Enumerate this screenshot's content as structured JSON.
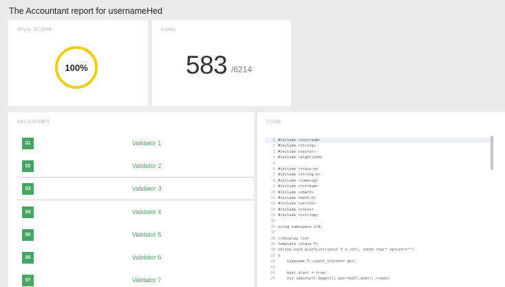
{
  "page": {
    "title": "The Accountant report for usernameHed"
  },
  "score": {
    "label": "FINAL SCORE",
    "value": "100%"
  },
  "rank": {
    "label": "RANK",
    "position": "583",
    "total": "/6214"
  },
  "validators": {
    "label": "VALIDATORS",
    "items": [
      {
        "badge": "01",
        "name": "Validator 1"
      },
      {
        "badge": "02",
        "name": "Validator 2"
      },
      {
        "badge": "03",
        "name": "Validator 3"
      },
      {
        "badge": "04",
        "name": "Validator 4"
      },
      {
        "badge": "05",
        "name": "Validator 5"
      },
      {
        "badge": "06",
        "name": "Validator 6"
      },
      {
        "badge": "07",
        "name": "Validator 7"
      }
    ]
  },
  "code": {
    "label": "CODE",
    "lines": [
      {
        "n": "1",
        "t": "#include <iostream>"
      },
      {
        "n": "2",
        "t": "#include <string>"
      },
      {
        "n": "3",
        "t": "#include <vector>"
      },
      {
        "n": "4",
        "t": "#include <algorithm>"
      },
      {
        "n": "5",
        "t": ""
      },
      {
        "n": "6",
        "t": "#include <stdio.h>"
      },
      {
        "n": "7",
        "t": "#include <string.h>"
      },
      {
        "n": "8",
        "t": "#include <iomanip>"
      },
      {
        "n": "9",
        "t": "#include <fstream>"
      },
      {
        "n": "10",
        "t": "#include <cmath>"
      },
      {
        "n": "11",
        "t": "#include <math.h>"
      },
      {
        "n": "12",
        "t": "#include <cerrno>"
      },
      {
        "n": "13",
        "t": "#include <cfenv>"
      },
      {
        "n": "14",
        "t": "#include <cstring>"
      },
      {
        "n": "15",
        "t": ""
      },
      {
        "n": "16",
        "t": "using namespace std;"
      },
      {
        "n": "17",
        "t": ""
      },
      {
        "n": "18",
        "t": "//display list"
      },
      {
        "n": "19",
        "t": "template <class T>"
      },
      {
        "n": "20",
        "t": "inline void printList(const T & coll, const char* optcstr=\"\")"
      },
      {
        "n": "21",
        "t": "{"
      },
      {
        "n": "22",
        "t": "    typename T::const_iterator pos;"
      },
      {
        "n": "23",
        "t": ""
      },
      {
        "n": "24",
        "t": "    bool start = true;"
      },
      {
        "n": "25",
        "t": "    for (pos=coll.begin(); pos!=coll.end(); ++pos)"
      }
    ]
  }
}
